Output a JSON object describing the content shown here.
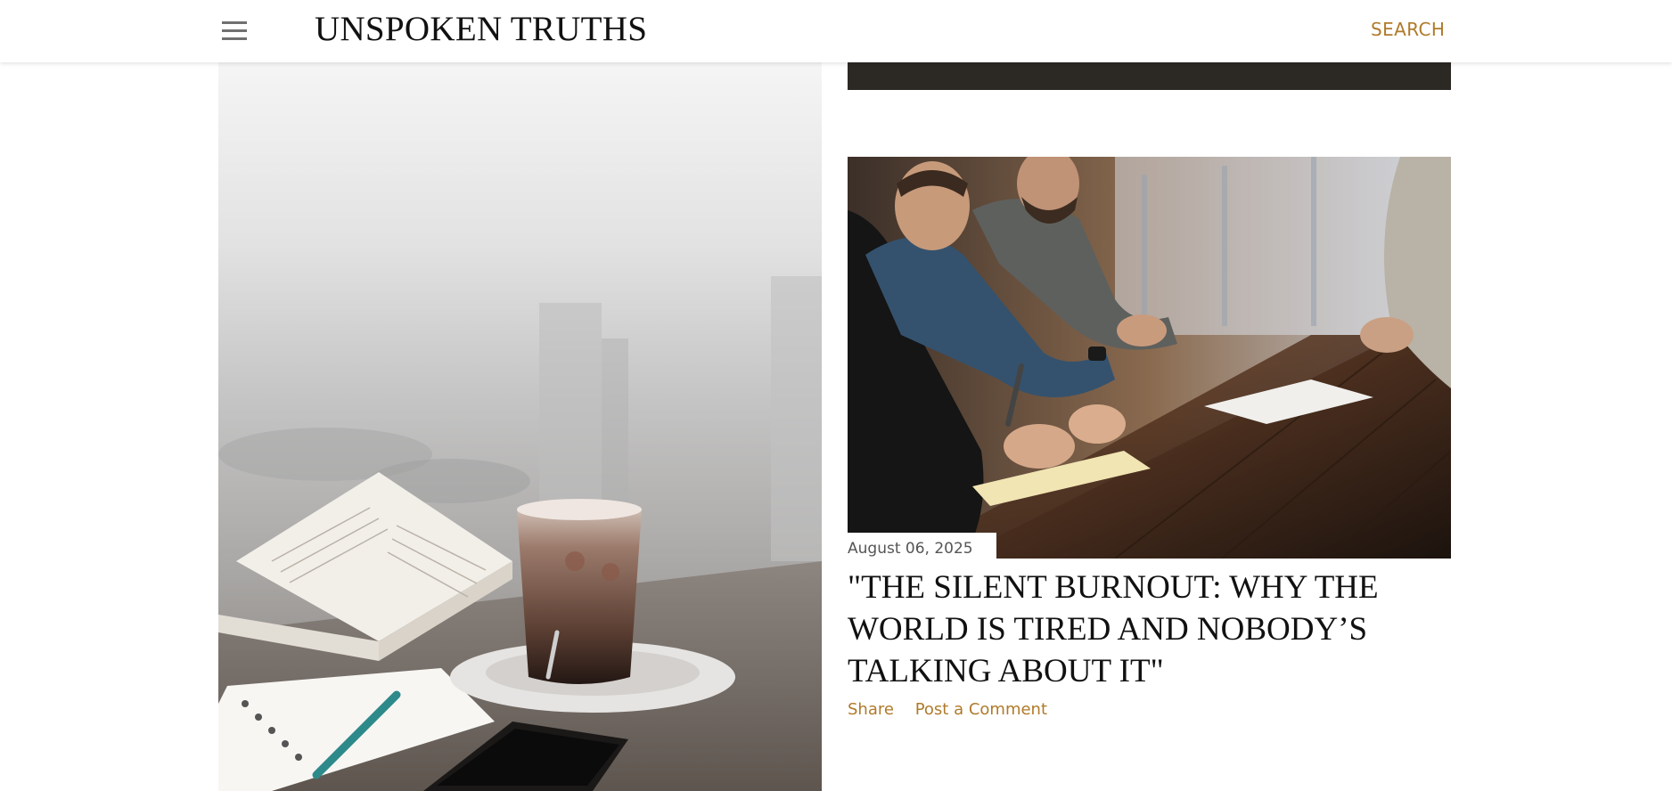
{
  "header": {
    "site_title": "UNSPOKEN TRUTHS",
    "search_label": "SEARCH",
    "menu_icon": "hamburger-menu-icon"
  },
  "posts": [
    {
      "image_subject": "coffee cup with open book, notebook and pen on a table by a window",
      "date": "",
      "title": ""
    },
    {
      "image_subject": "people seated at a wooden table writing notes in a meeting",
      "date": "August 06, 2025",
      "title": "\"THE SILENT BURNOUT: WHY THE WORLD IS TIRED AND NOBODY’S TALKING ABOUT IT\"",
      "share_label": "Share",
      "comment_label": "Post a Comment"
    }
  ],
  "colors": {
    "accent": "#b07a2a",
    "title_text": "#111111",
    "date_text": "#555555",
    "dark_band": "#2c2824"
  }
}
